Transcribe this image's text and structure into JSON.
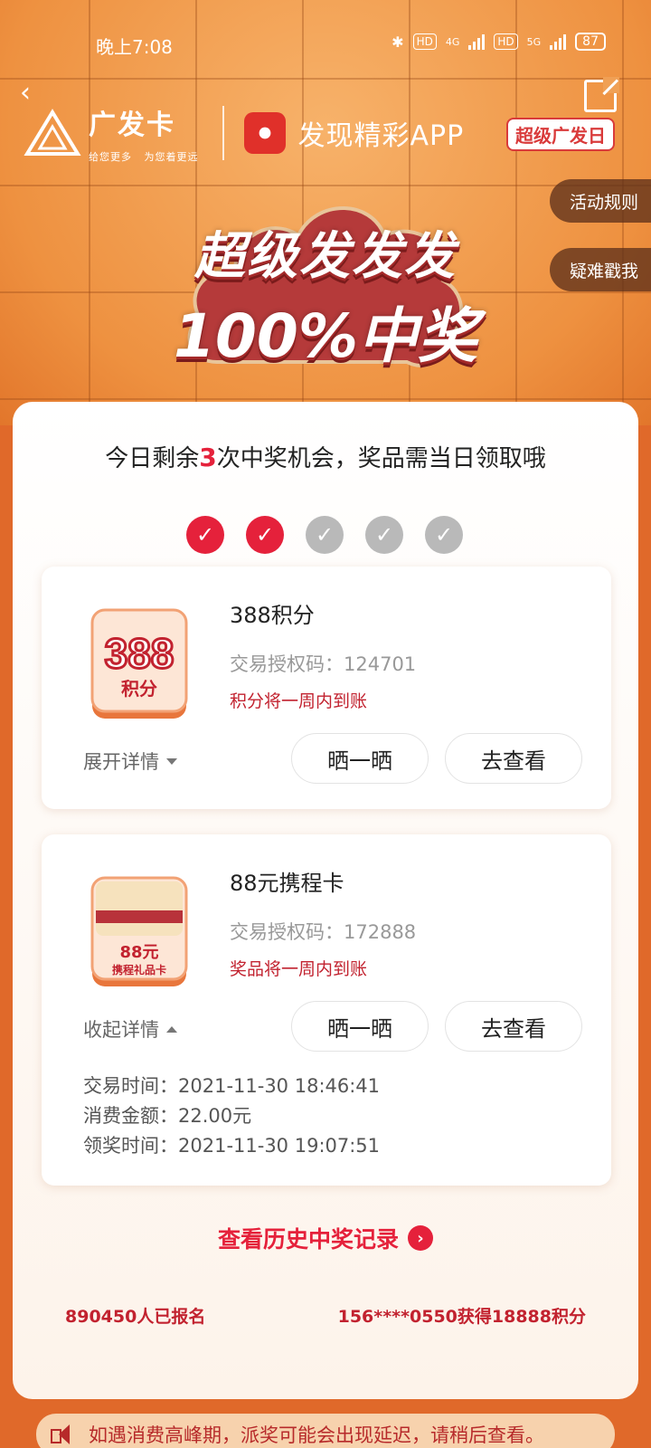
{
  "status_bar": {
    "time": "晚上7:08",
    "hd1": "HD",
    "network1": "4G",
    "hd2": "HD",
    "network2": "5G",
    "battery": "87"
  },
  "header": {
    "brand_name": "广发卡",
    "brand_sub_left": "给您更多",
    "brand_sub_right": "为您着更远",
    "app_name": "发现精彩APP",
    "campaign_badge": "超级广发日"
  },
  "side_buttons": {
    "rules": "活动规则",
    "help": "疑难戳我"
  },
  "banner": {
    "line1": "超级发发发",
    "line2": "100%中奖"
  },
  "chance": {
    "prefix": "今日剩余",
    "count": "3",
    "suffix": "次中奖机会，奖品需当日领取哦",
    "progress_done": 2,
    "progress_total": 5
  },
  "prizes": [
    {
      "badge_big": "388",
      "badge_small": "积分",
      "title": "388积分",
      "auth_code": "交易授权码：124701",
      "note": "积分将一周内到账",
      "toggle_label": "展开详情",
      "share_label": "晒一晒",
      "view_label": "去查看"
    },
    {
      "badge_big": "88元",
      "badge_small": "携程礼品卡",
      "title": "88元携程卡",
      "auth_code": "交易授权码：172888",
      "note": "奖品将一周内到账",
      "toggle_label": "收起详情",
      "share_label": "晒一晒",
      "view_label": "去查看",
      "details": {
        "trade_time": "交易时间：2021-11-30 18:46:41",
        "amount": "消费金额：22.00元",
        "claim_time": "领奖时间：2021-11-30 19:07:51"
      }
    }
  ],
  "history_link": "查看历史中奖记录",
  "footer": {
    "signups": "890450人已报名",
    "winner": "156****0550获得18888积分"
  },
  "notice": "如遇消费高峰期，派奖可能会出现延迟，请稍后查看。",
  "colors": {
    "accent_red": "#e5213b",
    "page_orange": "#e0692a",
    "check_off": "#b9b9b9"
  }
}
